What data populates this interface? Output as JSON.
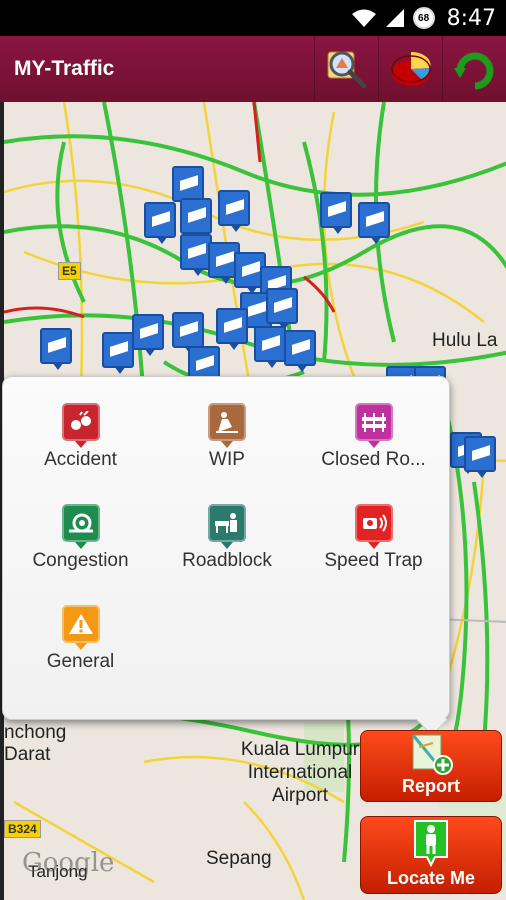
{
  "status_bar": {
    "time": "8:47",
    "battery": "68"
  },
  "app": {
    "title": "MY-Traffic"
  },
  "toolbar": {
    "search_icon": "map-search-icon",
    "chart_icon": "pie-chart-icon",
    "refresh_icon": "refresh-icon"
  },
  "map": {
    "labels": {
      "hulu": "Hulu La",
      "nchong": "nchong",
      "darat": "Darat",
      "klia": "Kuala Lumpur\nInternational\nAirport",
      "sepang": "Sepang",
      "tanjong": "Tanjong",
      "road_e5": "E5",
      "road_3324": "B324"
    },
    "attribution": "Google"
  },
  "report_menu": {
    "items": [
      {
        "label": "Accident",
        "color": "#c8262e",
        "icon": "accident-icon"
      },
      {
        "label": "WIP",
        "color": "#a8693e",
        "icon": "work-in-progress-icon"
      },
      {
        "label": "Closed Ro...",
        "color": "#c0309e",
        "icon": "closed-road-icon"
      },
      {
        "label": "Congestion",
        "color": "#1e8c4c",
        "icon": "congestion-icon"
      },
      {
        "label": "Roadblock",
        "color": "#2a7a6e",
        "icon": "roadblock-icon"
      },
      {
        "label": "Speed Trap",
        "color": "#e22323",
        "icon": "speed-trap-icon"
      },
      {
        "label": "General",
        "color": "#f29a16",
        "icon": "warning-icon"
      }
    ]
  },
  "buttons": {
    "report": "Report",
    "locate": "Locate Me"
  }
}
